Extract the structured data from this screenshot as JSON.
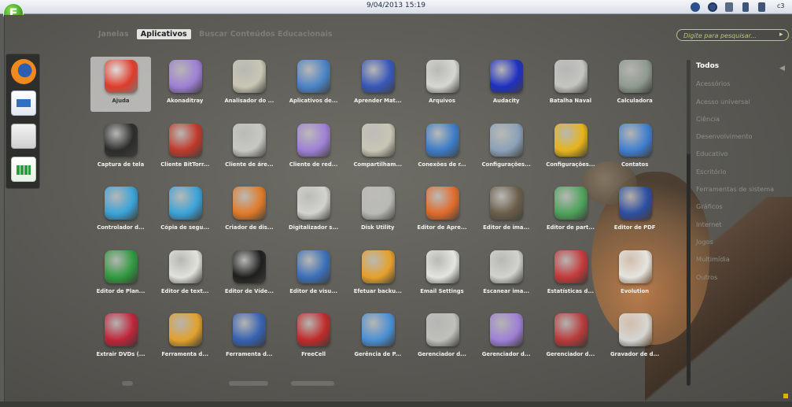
{
  "top_bar": {
    "datetime": "9/04/2013 15:19",
    "tray_text": "c3"
  },
  "launcher": {
    "logo_letter": "E"
  },
  "tabs": [
    {
      "label": "Janelas",
      "active": false
    },
    {
      "label": "Aplicativos",
      "active": true
    },
    {
      "label": "Buscar Conteúdos Educacionais",
      "active": false
    }
  ],
  "search": {
    "placeholder": "Digite para pesquisar..."
  },
  "dock": [
    "firefox-icon",
    "writer-document-icon",
    "file-cabinet-icon",
    "calc-spreadsheet-icon"
  ],
  "apps": [
    {
      "label": "Ajuda",
      "icon": "lifebuoy-icon",
      "color": "#e03b2a",
      "selected": true
    },
    {
      "label": "Akonaditray",
      "icon": "diamond-icon",
      "color": "#9f7fd6"
    },
    {
      "label": "Analisador do ...",
      "icon": "folder-chart-icon",
      "color": "#c9c6b4"
    },
    {
      "label": "Aplicativos de...",
      "icon": "window-arrows-icon",
      "color": "#4a83c7"
    },
    {
      "label": "Aprender Mat...",
      "icon": "graph-nodes-icon",
      "color": "#3657b8"
    },
    {
      "label": "Arquivos",
      "icon": "file-cabinet-icon",
      "color": "#d6d6d2"
    },
    {
      "label": "Audacity",
      "icon": "headphones-icon",
      "color": "#1e2fc2"
    },
    {
      "label": "Batalha Naval",
      "icon": "battleship-icon",
      "color": "#c4c4c0"
    },
    {
      "label": "Calculadora",
      "icon": "calculator-icon",
      "color": "#8e9a8e"
    },
    {
      "label": "Captura de tela",
      "icon": "camera-icon",
      "color": "#2c2c2c"
    },
    {
      "label": "Cliente BitTorr...",
      "icon": "download-arrow-icon",
      "color": "#c0392b"
    },
    {
      "label": "Cliente de áre...",
      "icon": "remote-desktop-icon",
      "color": "#c7c7c3"
    },
    {
      "label": "Cliente de red...",
      "icon": "diamond-icon",
      "color": "#9f7fd6"
    },
    {
      "label": "Compartilham...",
      "icon": "folder-icon",
      "color": "#c9c6b4"
    },
    {
      "label": "Conexões de r...",
      "icon": "network-computers-icon",
      "color": "#3b7bc8"
    },
    {
      "label": "Configurações...",
      "icon": "tools-icon",
      "color": "#8aa1b8"
    },
    {
      "label": "Configurações...",
      "icon": "ob-blocks-icon",
      "color": "#e7b418"
    },
    {
      "label": "Contatos",
      "icon": "address-book-icon",
      "color": "#3f7fd0"
    },
    {
      "label": "Controlador d...",
      "icon": "share-nodes-icon",
      "color": "#3aa3d9"
    },
    {
      "label": "Cópia de segu...",
      "icon": "share-nodes-icon",
      "color": "#3aa3d9"
    },
    {
      "label": "Criador de dis...",
      "icon": "usb-disk-icon",
      "color": "#e07a27"
    },
    {
      "label": "Digitalizador s...",
      "icon": "scanner-icon",
      "color": "#d2d2ce"
    },
    {
      "label": "Disk Utility",
      "icon": "disk-utility-icon",
      "color": "#b9b9b5"
    },
    {
      "label": "Editor de Apre...",
      "icon": "presentation-icon",
      "color": "#e06a2a"
    },
    {
      "label": "Editor de ima...",
      "icon": "gimp-icon",
      "color": "#6b5e4a"
    },
    {
      "label": "Editor de part...",
      "icon": "partition-icon",
      "color": "#4da35a"
    },
    {
      "label": "Editor de PDF",
      "icon": "pdf-editor-icon",
      "color": "#2a4fa5"
    },
    {
      "label": "Editor de Plan...",
      "icon": "spreadsheet-icon",
      "color": "#2f9a3e"
    },
    {
      "label": "Editor de text...",
      "icon": "text-editor-icon",
      "color": "#e2e2dc"
    },
    {
      "label": "Editor de Víde...",
      "icon": "video-clapper-icon",
      "color": "#1e1e1e"
    },
    {
      "label": "Editor de visu...",
      "icon": "flag-icon",
      "color": "#3a6fb8"
    },
    {
      "label": "Efetuar backu...",
      "icon": "backup-disc-icon",
      "color": "#e6a02a"
    },
    {
      "label": "Email Settings",
      "icon": "mail-clock-icon",
      "color": "#e4e4e0"
    },
    {
      "label": "Escanear ima...",
      "icon": "scanner-icon",
      "color": "#d2d2ce"
    },
    {
      "label": "Estatísticas d...",
      "icon": "line-chart-icon",
      "color": "#c43a3a"
    },
    {
      "label": "Evolution",
      "icon": "mail-clock-icon",
      "color": "#e4e4e0"
    },
    {
      "label": "Extrair DVDs (...",
      "icon": "dvd-icon",
      "color": "#c0243a"
    },
    {
      "label": "Ferramenta d...",
      "icon": "draw-icon",
      "color": "#e2a12c"
    },
    {
      "label": "Ferramenta d...",
      "icon": "microscope-icon",
      "color": "#3561b2"
    },
    {
      "label": "FreeCell",
      "icon": "cards-icon",
      "color": "#c02a2a"
    },
    {
      "label": "Gerência de P...",
      "icon": "gantt-icon",
      "color": "#4a8fd4"
    },
    {
      "label": "Gerenciador d...",
      "icon": "package-icon",
      "color": "#bfbfbb"
    },
    {
      "label": "Gerenciador d...",
      "icon": "diamond-icon",
      "color": "#9f7fd6"
    },
    {
      "label": "Gerenciador d...",
      "icon": "archive-manager-icon",
      "color": "#b83a3a"
    },
    {
      "label": "Gravador de d...",
      "icon": "disc-burner-icon",
      "color": "#d6d6d2"
    }
  ],
  "categories": [
    "Todos",
    "Acessórios",
    "Acesso universal",
    "Ciência",
    "Desenvolvimento",
    "Educativo",
    "Escritório",
    "Ferramentas de sistema",
    "Gráficos",
    "Internet",
    "Jogos",
    "Multimídia",
    "Outros"
  ],
  "active_category": "Todos",
  "colors": {
    "background": "#5b5b57",
    "tab_active": "#e4e4e0",
    "search_border": "#b6cc7a",
    "topbar": "#e8ebf0",
    "logo_green": "#3d9a1c"
  }
}
